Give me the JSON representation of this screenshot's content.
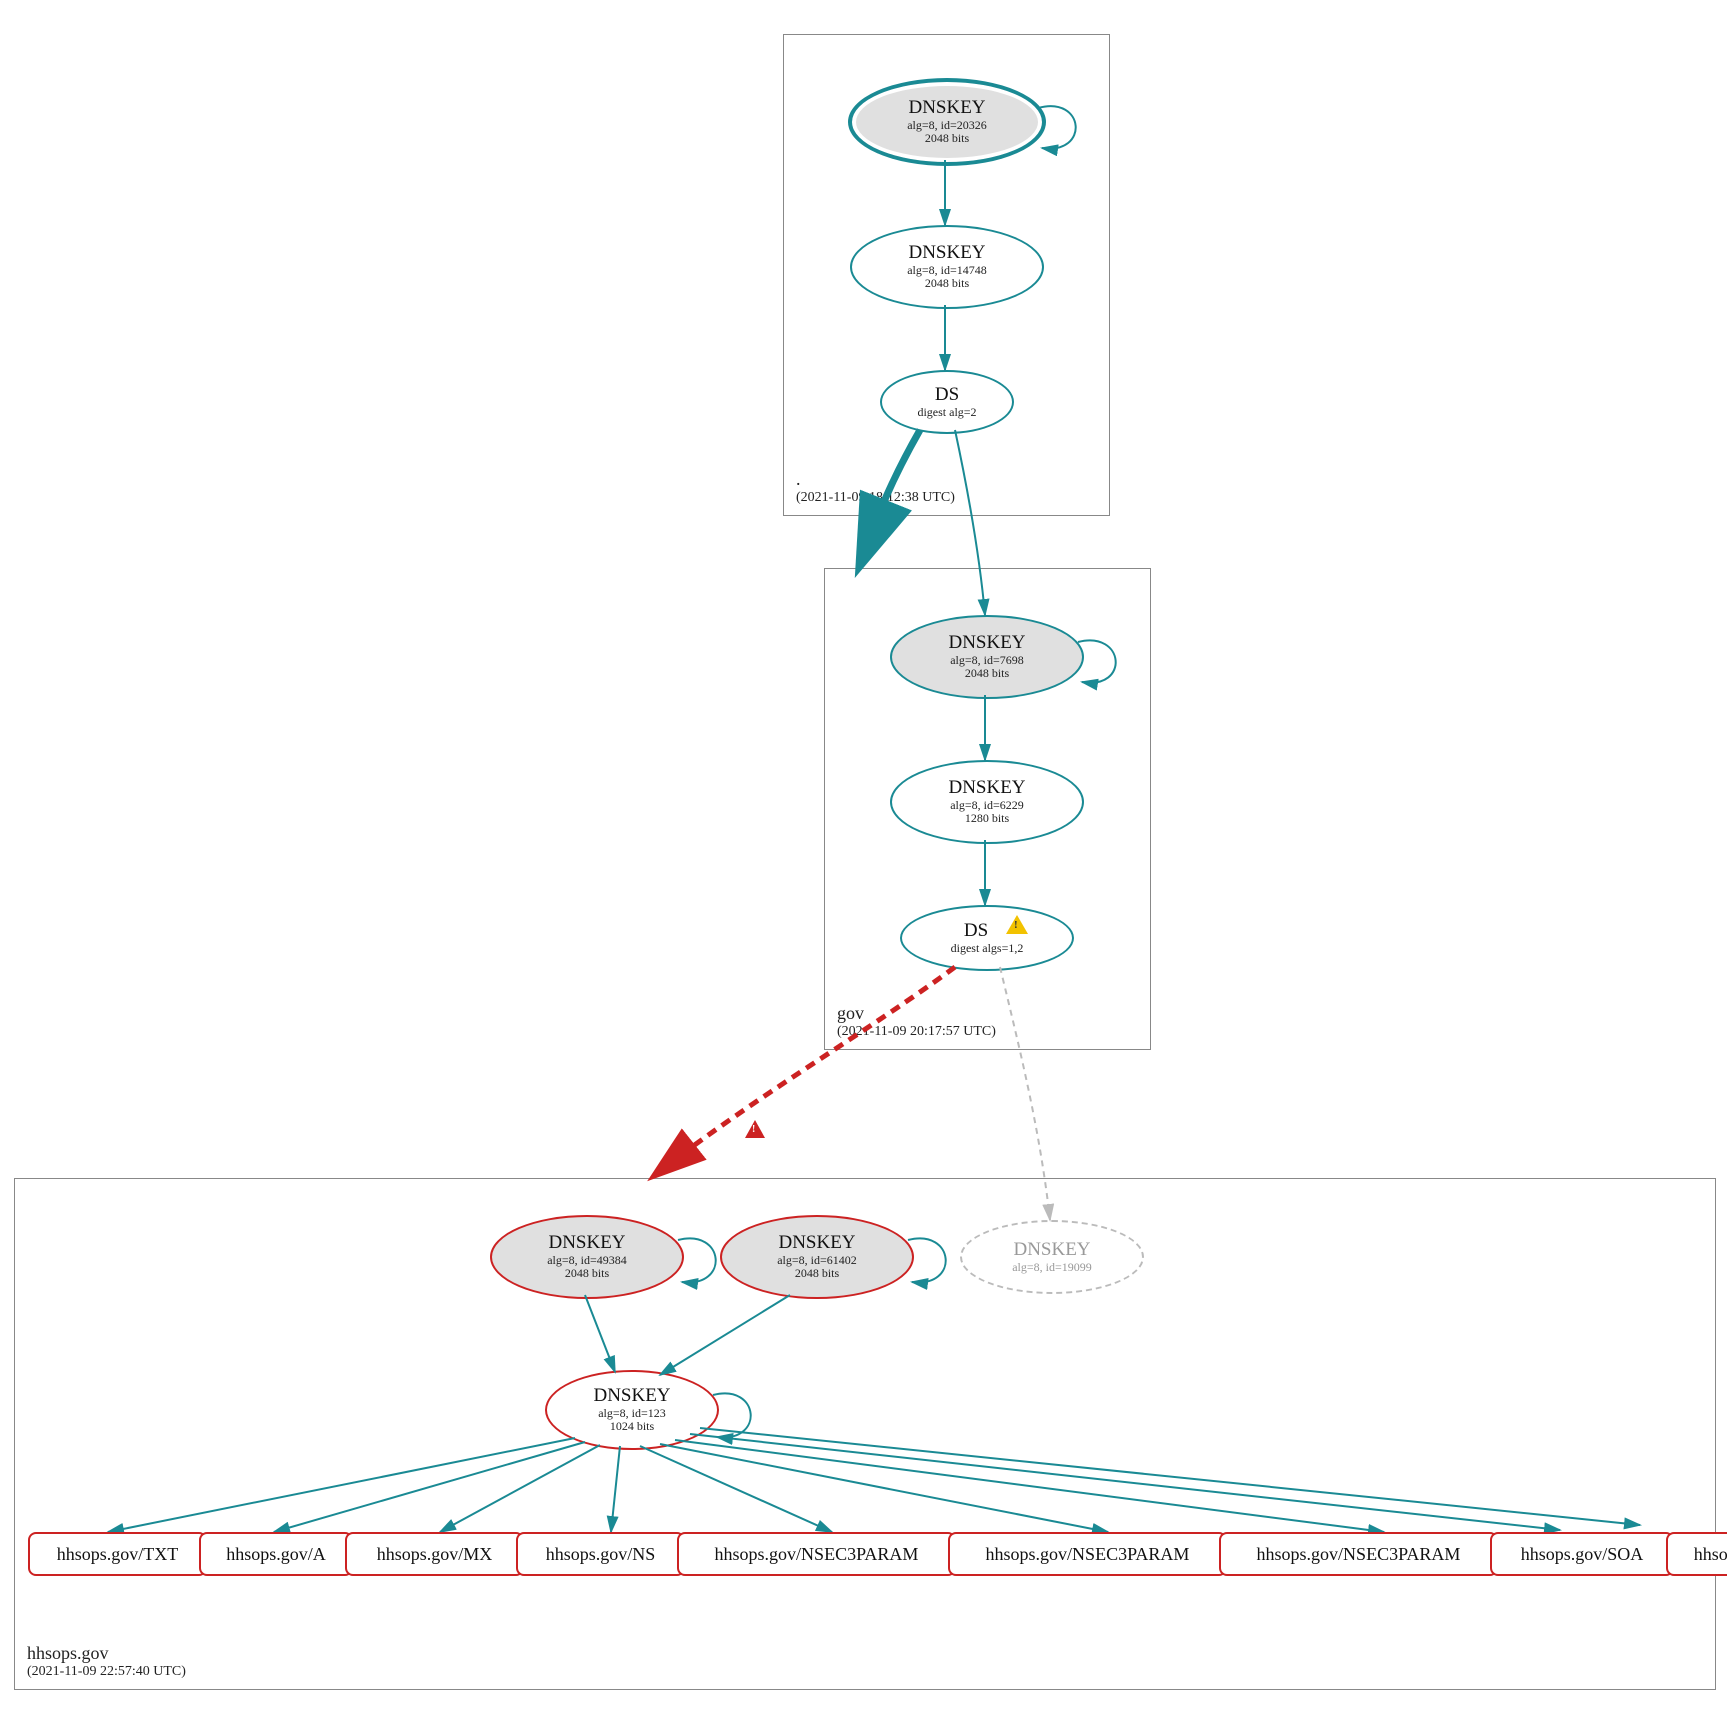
{
  "zones": {
    "root": {
      "name": ".",
      "timestamp": "(2021-11-09 18:12:38 UTC)"
    },
    "gov": {
      "name": "gov",
      "timestamp": "(2021-11-09 20:17:57 UTC)"
    },
    "hhs": {
      "name": "hhsops.gov",
      "timestamp": "(2021-11-09 22:57:40 UTC)"
    }
  },
  "nodes": {
    "root_ksk": {
      "title": "DNSKEY",
      "l1": "alg=8, id=20326",
      "l2": "2048 bits"
    },
    "root_zsk": {
      "title": "DNSKEY",
      "l1": "alg=8, id=14748",
      "l2": "2048 bits"
    },
    "root_ds": {
      "title": "DS",
      "l1": "digest alg=2",
      "l2": ""
    },
    "gov_ksk": {
      "title": "DNSKEY",
      "l1": "alg=8, id=7698",
      "l2": "2048 bits"
    },
    "gov_zsk": {
      "title": "DNSKEY",
      "l1": "alg=8, id=6229",
      "l2": "1280 bits"
    },
    "gov_ds": {
      "title": "DS",
      "l1": "digest algs=1,2",
      "l2": ""
    },
    "hhs_k1": {
      "title": "DNSKEY",
      "l1": "alg=8, id=49384",
      "l2": "2048 bits"
    },
    "hhs_k2": {
      "title": "DNSKEY",
      "l1": "alg=8, id=61402",
      "l2": "2048 bits"
    },
    "hhs_kf": {
      "title": "DNSKEY",
      "l1": "alg=8, id=19099",
      "l2": ""
    },
    "hhs_zsk": {
      "title": "DNSKEY",
      "l1": "alg=8, id=123",
      "l2": "1024 bits"
    }
  },
  "rrsets": [
    "hhsops.gov/TXT",
    "hhsops.gov/A",
    "hhsops.gov/MX",
    "hhsops.gov/NS",
    "hhsops.gov/NSEC3PARAM",
    "hhsops.gov/NSEC3PARAM",
    "hhsops.gov/NSEC3PARAM",
    "hhsops.gov/SOA",
    "hhsops.gov/AAAA"
  ],
  "colors": {
    "teal": "#1a8a94",
    "red": "#c22",
    "grey": "#bbb"
  }
}
